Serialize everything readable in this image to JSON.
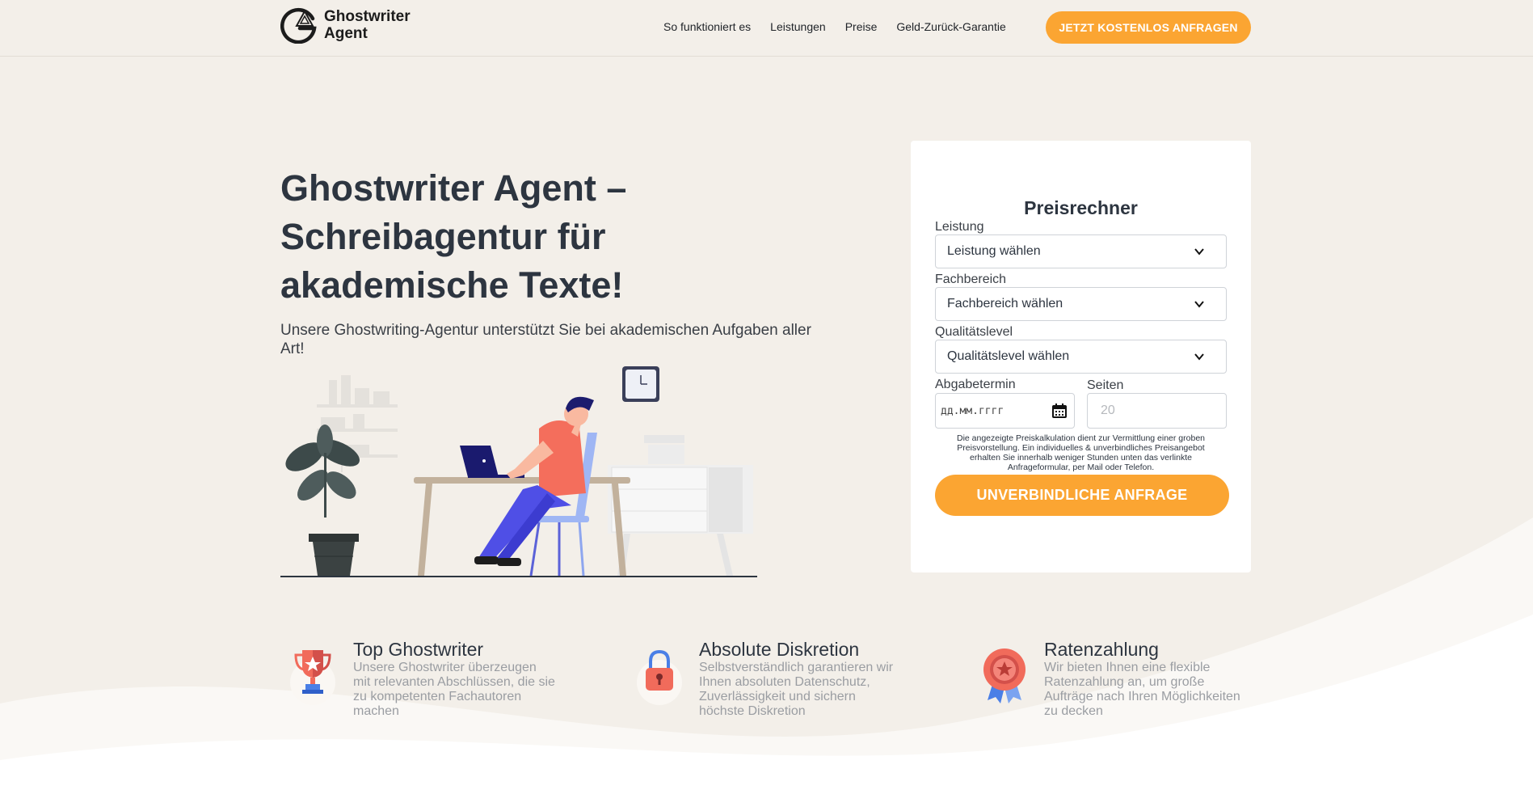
{
  "header": {
    "logo_line1": "Ghostwriter",
    "logo_line2": "Agent",
    "nav": [
      "So funktioniert es",
      "Leistungen",
      "Preise",
      "Geld-Zurück-Garantie"
    ],
    "cta": "JETZT KOSTENLOS ANFRAGEN"
  },
  "hero": {
    "title_line1": "Ghostwriter Agent –",
    "title_line2": "Schreibagentur für",
    "title_line3": "akademische Texte!",
    "subtitle": "Unsere Ghostwriting-Agentur unterstützt Sie bei akademischen Aufgaben aller Art!"
  },
  "form": {
    "title": "Preisrechner",
    "leistung_label": "Leistung",
    "leistung_value": "Leistung wählen",
    "fachbereich_label": "Fachbereich",
    "fachbereich_value": "Fachbereich wählen",
    "qualitaet_label": "Qualitätslevel",
    "qualitaet_value": "Qualitätslevel wählen",
    "abgabe_label": "Abgabetermin",
    "abgabe_placeholder": "дд.мм.гггг",
    "seiten_label": "Seiten",
    "seiten_placeholder": "20",
    "note": "Die angezeigte Preiskalkulation dient zur Vermittlung einer groben Preisvorstellung. Ein individuelles & unverbindliches Preisangebot erhalten Sie innerhalb weniger Stunden unten das verlinkte Anfrageformular, per Mail oder Telefon.",
    "cta": "UNVERBINDLICHE ANFRAGE"
  },
  "features": [
    {
      "icon": "trophy-icon",
      "title": "Top Ghostwriter",
      "text": "Unsere Ghostwriter überzeugen mit relevanten Abschlüssen, die sie zu kompetenten Fachautoren machen"
    },
    {
      "icon": "padlock-icon",
      "title": "Absolute Diskretion",
      "text": "Selbstverständlich garantieren wir Ihnen absoluten Datenschutz, Zuverlässigkeit und sichern höchste Diskretion"
    },
    {
      "icon": "medal-icon",
      "title": "Ratenzahlung",
      "text": "Wir bieten Ihnen eine flexible Ratenzahlung an, um große Aufträge nach Ihren Möglichkeiten zu decken"
    }
  ],
  "colors": {
    "accent": "#fba532",
    "background": "#f3efe9",
    "text": "#2d3540"
  }
}
